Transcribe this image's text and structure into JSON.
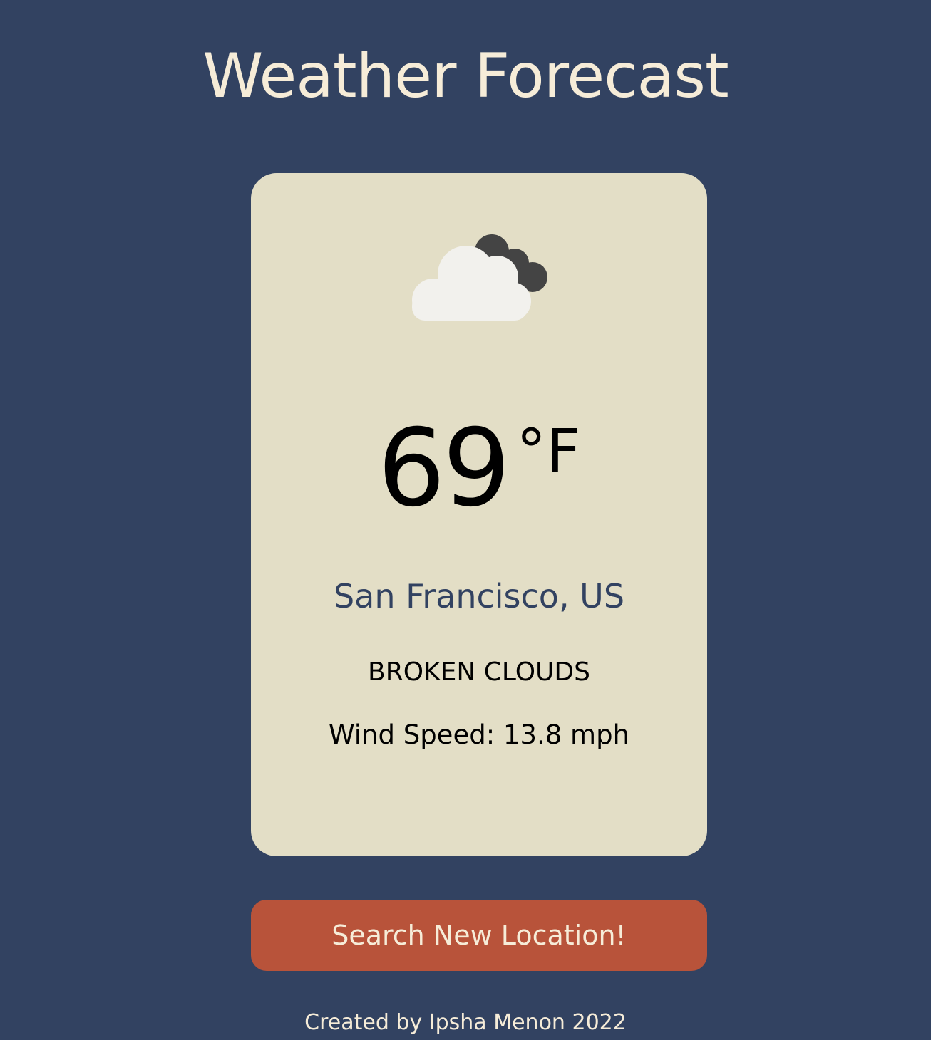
{
  "page": {
    "title": "Weather Forecast",
    "footer": "Created by Ipsha Menon 2022"
  },
  "colors": {
    "background": "#324261",
    "card": "#e3dec6",
    "title_text": "#f6ecd8",
    "city_text": "#324261",
    "button": "#b8533a"
  },
  "weather": {
    "icon": "broken-clouds-icon",
    "temperature": "69",
    "unit": "°F",
    "location": "San Francisco, US",
    "condition": "BROKEN CLOUDS",
    "wind": "Wind Speed: 13.8 mph"
  },
  "actions": {
    "search_label": "Search New Location!"
  }
}
